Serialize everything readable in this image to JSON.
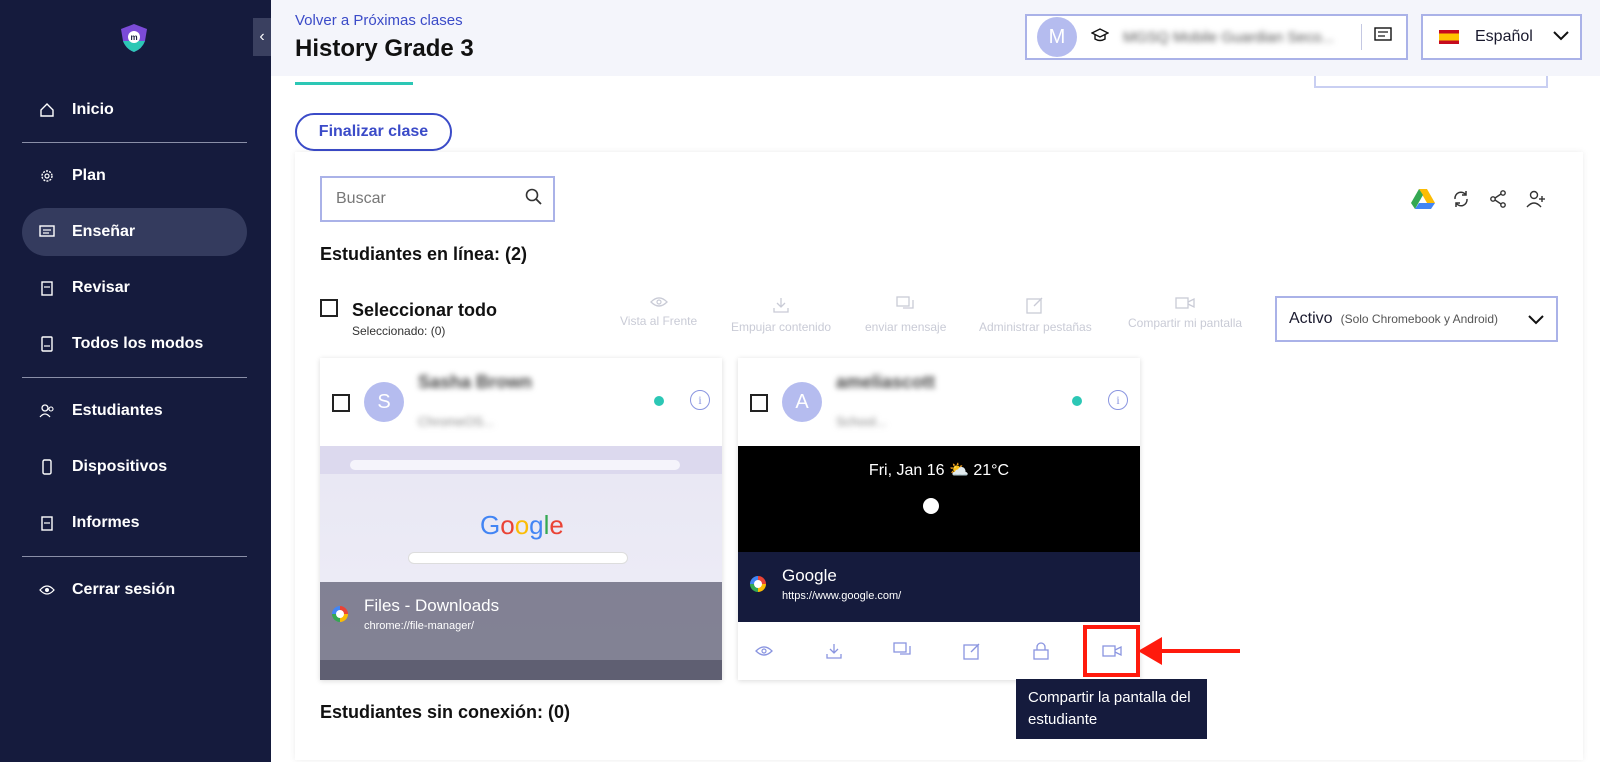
{
  "sidebar": {
    "items": [
      {
        "label": "Inicio",
        "icon": "home-icon"
      },
      {
        "label": "Plan",
        "icon": "gear-icon"
      },
      {
        "label": "Enseñar",
        "icon": "teach-icon",
        "active": true
      },
      {
        "label": "Revisar",
        "icon": "clipboard-icon"
      },
      {
        "label": "Todos los modos",
        "icon": "document-icon"
      },
      {
        "label": "Estudiantes",
        "icon": "students-icon"
      },
      {
        "label": "Dispositivos",
        "icon": "phone-icon"
      },
      {
        "label": "Informes",
        "icon": "report-icon"
      },
      {
        "label": "Cerrar sesión",
        "icon": "eye-icon"
      }
    ]
  },
  "header": {
    "back_link": "Volver a Próximas clases",
    "title": "History Grade 3",
    "avatar_initial": "M",
    "school_name": "MGSQ Mobile Guardian Seco...",
    "language": "Español"
  },
  "finalize_button": "Finalizar clase",
  "search": {
    "placeholder": "Buscar"
  },
  "online_label": "Estudiantes en línea: (2)",
  "select_all": {
    "label": "Seleccionar todo",
    "count": "Seleccionado: (0)"
  },
  "actions": [
    "Vista al Frente",
    "Empujar contenido",
    "enviar mensaje",
    "Administrar pestañas",
    "Compartir mi pantalla"
  ],
  "status_dropdown": {
    "value": "Activo",
    "hint": "(Solo Chromebook y Android)"
  },
  "students": [
    {
      "initial": "S",
      "name": "Sasha Brown",
      "device": "ChromeOS...",
      "screen_title": "Files - Downloads",
      "screen_url": "chrome://file-manager/",
      "logo": "Google"
    },
    {
      "initial": "A",
      "name": "ameliascott",
      "device": "School...",
      "lock_text": "Fri, Jan 16 ⛅ 21°C",
      "screen_title": "Google",
      "screen_url": "https://www.google.com/"
    }
  ],
  "tooltip": "Compartir la pantalla del estudiante",
  "offline_label": "Estudiantes sin conexión: (0)",
  "colors": {
    "sidebar": "#151b3d",
    "accent": "#3b4bc8",
    "online": "#2cc7b5",
    "highlight": "#ff1a0d"
  }
}
